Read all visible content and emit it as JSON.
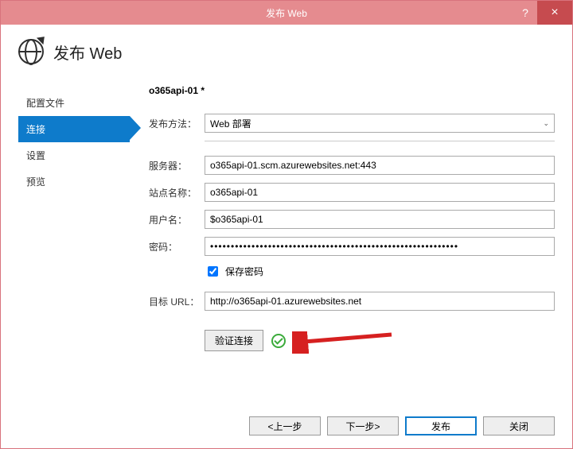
{
  "window": {
    "title": "发布 Web"
  },
  "header": {
    "title": "发布 Web"
  },
  "sidebar": {
    "steps": [
      {
        "label": "配置文件",
        "active": false
      },
      {
        "label": "连接",
        "active": true
      },
      {
        "label": "设置",
        "active": false
      },
      {
        "label": "预览",
        "active": false
      }
    ]
  },
  "content": {
    "profile_name": "o365api-01 *",
    "publish_method_label": "发布方法：",
    "publish_method_value": "Web 部署",
    "server_label": "服务器：",
    "server_value": "o365api-01.scm.azurewebsites.net:443",
    "site_label": "站点名称：",
    "site_value": "o365api-01",
    "user_label": "用户名：",
    "user_value": "$o365api-01",
    "password_label": "密码：",
    "password_value": "••••••••••••••••••••••••••••••••••••••••••••••••••••••••••••",
    "save_password_label": "保存密码",
    "target_url_label": "目标 URL：",
    "target_url_value": "http://o365api-01.azurewebsites.net",
    "validate_label": "验证连接"
  },
  "footer": {
    "prev": "<上一步",
    "next": "下一步>",
    "publish": "发布",
    "close": "关闭"
  }
}
